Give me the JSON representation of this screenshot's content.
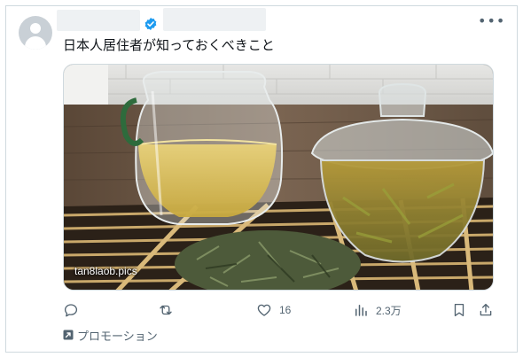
{
  "post": {
    "text": "日本人居住者が知っておくべきこと",
    "verified": true,
    "media": {
      "label": "tan8laob.pics",
      "alt": ""
    }
  },
  "actions": {
    "reply_count": "",
    "repost_count": "",
    "like_count": "16",
    "views_count": "2.3万"
  },
  "promo": {
    "label": "プロモーション"
  },
  "colors": {
    "accent": "#1d9bf0",
    "muted": "#536471",
    "border": "#cfd9de"
  },
  "icons": [
    "more-icon",
    "verified-icon",
    "reply-icon",
    "repost-icon",
    "like-icon",
    "views-icon",
    "bookmark-icon",
    "share-icon",
    "promoted-icon"
  ]
}
